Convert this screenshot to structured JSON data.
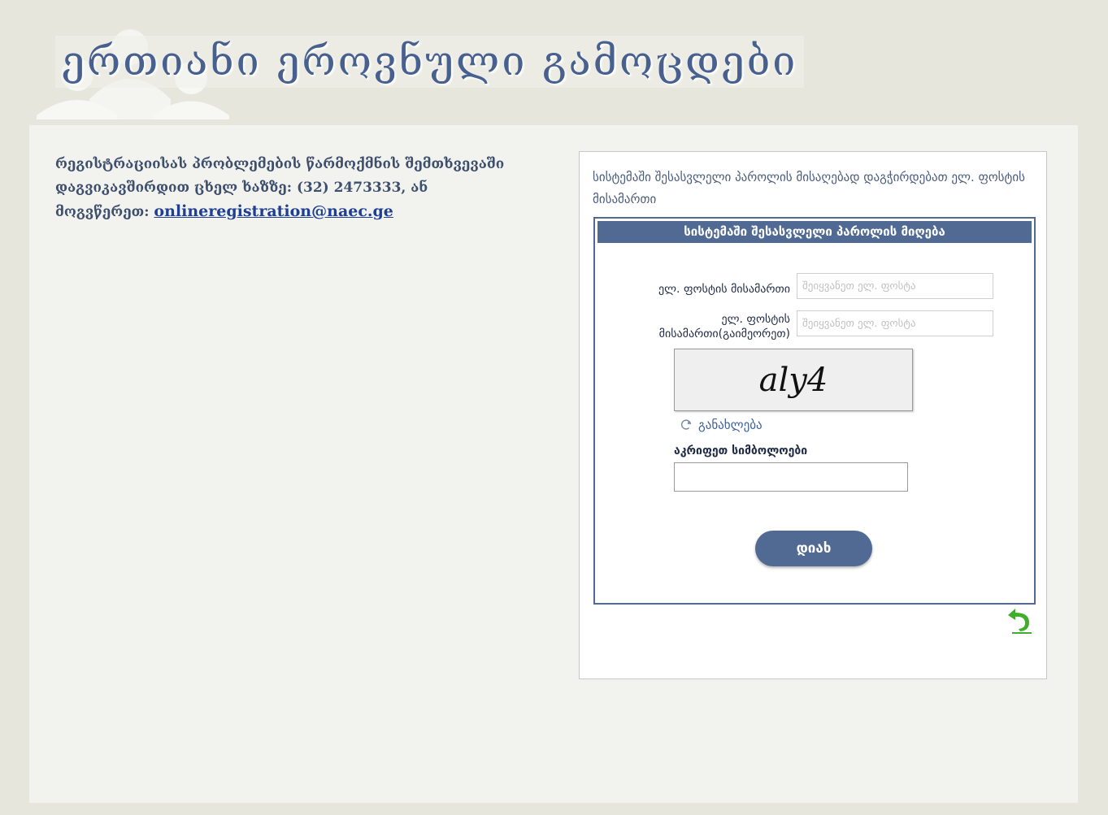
{
  "header": {
    "title": "ერთიანი ეროვნული გამოცდები"
  },
  "help": {
    "line1": "რეგისტრაციისას პრობლემების წარმოქმნის შემთხვევაში",
    "line2": "დაგვიკავშირდით  ცხელ ხაზზე: (32) 2473333, ან",
    "prefix": "მოგვწერეთ: ",
    "email": "onlineregistration@naec.ge"
  },
  "panel": {
    "info": "სისტემაში შესასვლელი პაროლის მისაღებად დაგჭირდებათ ელ. ფოსტის მისამართი",
    "form_title": "სისტემაში შესასვლელი პაროლის მიღება",
    "email_label": "ელ. ფოსტის მისამართი",
    "email_placeholder": "შეიყვანეთ ელ. ფოსტა",
    "confirm_label": "ელ. ფოსტის მისამართი(გაიმეორეთ)",
    "confirm_placeholder": "შეიყვანეთ ელ. ფოსტა",
    "captcha_text": "aly4",
    "refresh_label": "განახლება",
    "verify_label": "აკრიფეთ სიმბოლოები",
    "submit_label": "დიახ"
  },
  "icons": {
    "refresh": "refresh-icon",
    "back": "back-arrow-icon",
    "header_people": "people-icon"
  },
  "colors": {
    "accent": "#516a93",
    "back_arrow": "#3fae2a"
  }
}
